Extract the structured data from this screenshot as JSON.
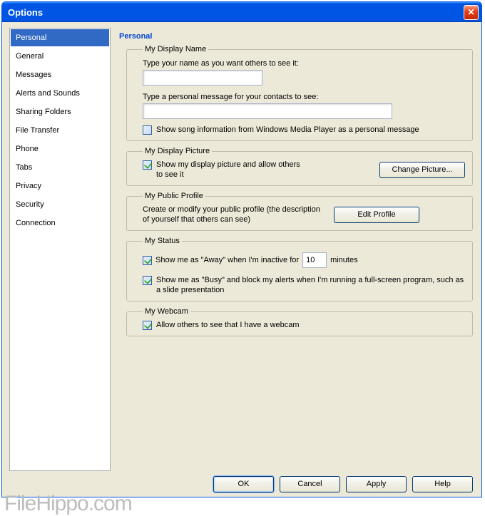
{
  "window": {
    "title": "Options",
    "close_glyph": "✕"
  },
  "sidebar": {
    "items": [
      {
        "label": "Personal",
        "selected": true
      },
      {
        "label": "General"
      },
      {
        "label": "Messages"
      },
      {
        "label": "Alerts and Sounds"
      },
      {
        "label": "Sharing Folders"
      },
      {
        "label": "File Transfer"
      },
      {
        "label": "Phone"
      },
      {
        "label": "Tabs"
      },
      {
        "label": "Privacy"
      },
      {
        "label": "Security"
      },
      {
        "label": "Connection"
      }
    ]
  },
  "panel": {
    "heading": "Personal",
    "display_name": {
      "legend": "My Display Name",
      "name_label": "Type your name as you want others to see it:",
      "name_value": "",
      "msg_label": "Type a personal message for your contacts to see:",
      "msg_value": "",
      "song_chk": "Show song information from Windows Media Player as a personal message",
      "song_checked": false
    },
    "display_picture": {
      "legend": "My Display Picture",
      "show_label": "Show my display picture and allow others to see it",
      "show_checked": true,
      "button": "Change Picture..."
    },
    "public_profile": {
      "legend": "My Public Profile",
      "desc": "Create or modify your public profile (the description of yourself that others can see)",
      "button": "Edit Profile"
    },
    "status": {
      "legend": "My Status",
      "away_prefix": "Show me as \"Away\" when I'm inactive for",
      "away_value": "10",
      "away_suffix": "minutes",
      "away_checked": true,
      "busy_label": "Show me as \"Busy\" and block my alerts when I'm running a full-screen program, such as a slide presentation",
      "busy_checked": true
    },
    "webcam": {
      "legend": "My Webcam",
      "allow_label": "Allow others to see that I have a webcam",
      "allow_checked": true
    }
  },
  "footer": {
    "ok": "OK",
    "cancel": "Cancel",
    "apply": "Apply",
    "help": "Help"
  },
  "watermark": "FileHippo.com"
}
